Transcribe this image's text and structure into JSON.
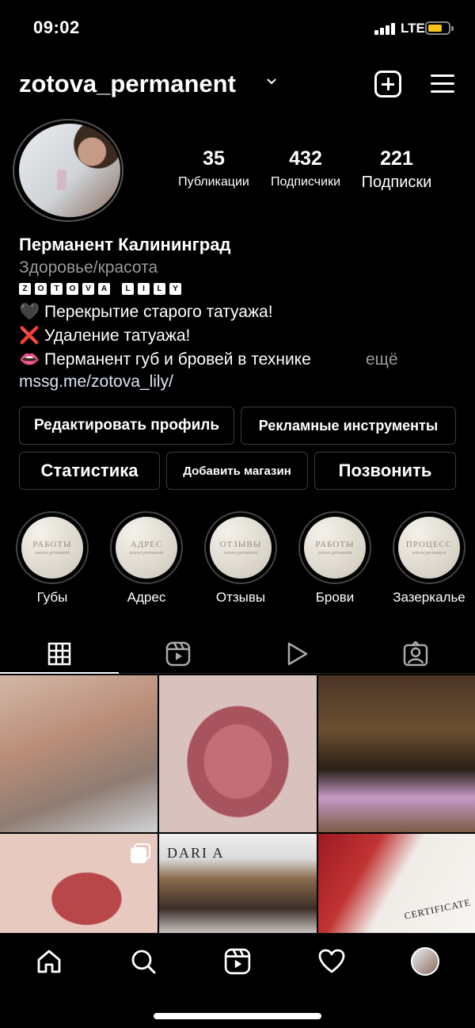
{
  "status_bar": {
    "time": "09:02",
    "network": "LTE"
  },
  "header": {
    "username": "zotova_permanent"
  },
  "stats": [
    {
      "count": "35",
      "label": "Публикации"
    },
    {
      "count": "432",
      "label": "Подписчики"
    },
    {
      "count": "221",
      "label": "Подписки"
    }
  ],
  "bio": {
    "name": "Перманент Калининград",
    "category": "Здоровье/красота",
    "brand_letters": [
      "Z",
      "O",
      "T",
      "O",
      "V",
      "A",
      "",
      "L",
      "I",
      "L",
      "Y"
    ],
    "lines": [
      {
        "emoji": "🖤",
        "text": "Перекрытие старого татуажа!"
      },
      {
        "emoji": "❌",
        "text": "Удаление татуажа!"
      },
      {
        "emoji": "👄",
        "text": "Перманент губ и бровей в технике"
      }
    ],
    "more": "ещё",
    "link": "mssg.me/zotova_lily/"
  },
  "buttons": {
    "edit_profile": "Редактировать профиль",
    "ad_tools": "Рекламные инструменты",
    "statistics": "Статистика",
    "add_shop": "Добавить магазин",
    "call": "Позвонить"
  },
  "highlights": [
    {
      "cover_title": "РАБОТЫ",
      "cover_sub": "zotova permanent",
      "label": "Губы"
    },
    {
      "cover_title": "АДРЕС",
      "cover_sub": "zotova permanent",
      "label": "Адрес"
    },
    {
      "cover_title": "ОТЗЫВЫ",
      "cover_sub": "zotova permanent",
      "label": "Отзывы"
    },
    {
      "cover_title": "РАБОТЫ",
      "cover_sub": "zotova permanent",
      "label": "Брови"
    },
    {
      "cover_title": "ПРОЦЕСС",
      "cover_sub": "zotova permanent",
      "label": "Зазеркалье"
    }
  ],
  "tabs": [
    {
      "icon": "grid-icon",
      "active": true
    },
    {
      "icon": "reels-icon",
      "active": false
    },
    {
      "icon": "igtv-play-icon",
      "active": false
    },
    {
      "icon": "tagged-icon",
      "active": false
    }
  ],
  "grid_posts": [
    {
      "subject": "eyebrows-closeup"
    },
    {
      "subject": "lips-closeup"
    },
    {
      "subject": "master-at-work"
    },
    {
      "subject": "lips-closeup-2",
      "multi": true
    },
    {
      "subject": "two-women-with-certificate",
      "sign_text": "DARI        A"
    },
    {
      "subject": "certificate-with-roses",
      "sign_text": "CERTIFICATE"
    }
  ],
  "bottom_nav": [
    "home-icon",
    "search-icon",
    "reels-icon",
    "heart-icon",
    "profile-avatar"
  ],
  "colors": {
    "background": "#000000",
    "muted_text": "#9a9a9a",
    "link": "#dbe4f5",
    "border": "#3a3a3a",
    "battery": "#f5c518"
  }
}
